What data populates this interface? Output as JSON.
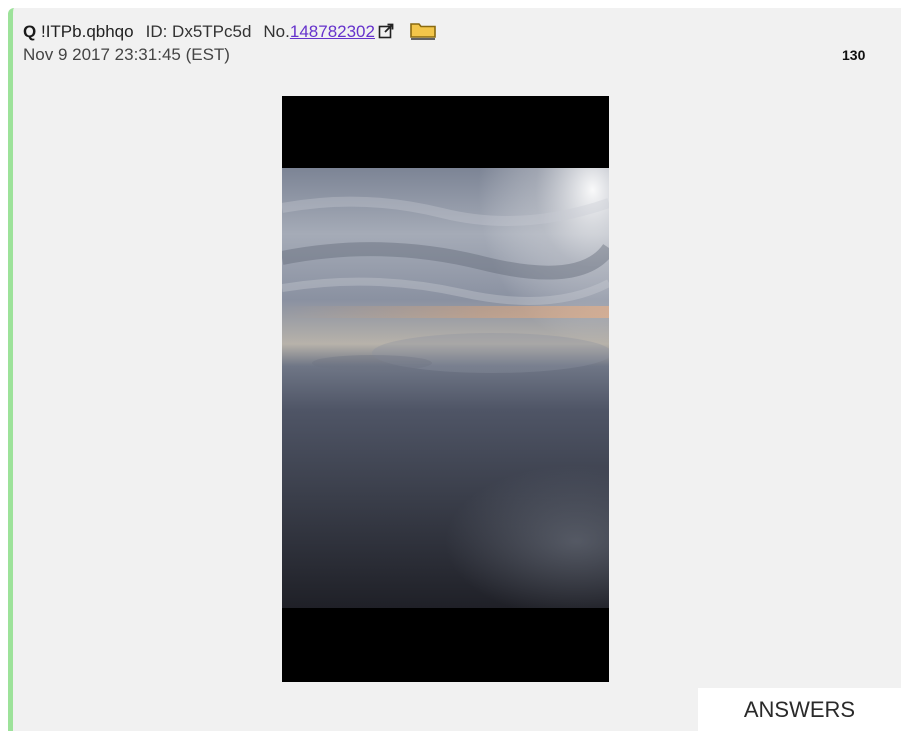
{
  "post": {
    "author": "Q",
    "tripcode": "!ITPb.qbhqo",
    "id_text": "ID: Dx5TPc5d",
    "number_prefix": "No.",
    "number": "148782302",
    "timestamp": "Nov 9 2017 23:31:45 (EST)",
    "count": "130",
    "accent_color": "#9de29a",
    "link_color": "#6633cc"
  },
  "icons": {
    "external_link": "external-link-icon",
    "folder": "folder-icon"
  },
  "media": {
    "alt": "photo"
  },
  "footer": {
    "answers_label": "ANSWERS"
  }
}
